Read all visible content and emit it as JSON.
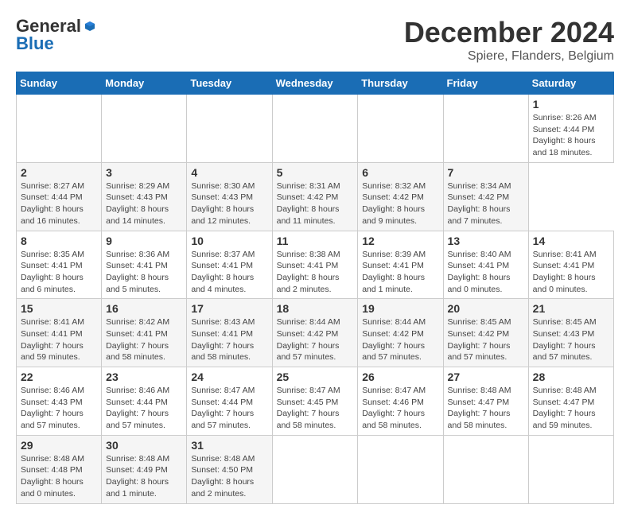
{
  "logo": {
    "general": "General",
    "blue": "Blue"
  },
  "title": {
    "month_year": "December 2024",
    "location": "Spiere, Flanders, Belgium"
  },
  "calendar": {
    "days_of_week": [
      "Sunday",
      "Monday",
      "Tuesday",
      "Wednesday",
      "Thursday",
      "Friday",
      "Saturday"
    ],
    "weeks": [
      [
        null,
        null,
        null,
        null,
        null,
        null,
        {
          "day": "1",
          "sunrise": "Sunrise: 8:26 AM",
          "sunset": "Sunset: 4:44 PM",
          "daylight": "Daylight: 8 hours and 18 minutes."
        }
      ],
      [
        {
          "day": "2",
          "sunrise": "Sunrise: 8:27 AM",
          "sunset": "Sunset: 4:44 PM",
          "daylight": "Daylight: 8 hours and 16 minutes."
        },
        {
          "day": "3",
          "sunrise": "Sunrise: 8:29 AM",
          "sunset": "Sunset: 4:43 PM",
          "daylight": "Daylight: 8 hours and 14 minutes."
        },
        {
          "day": "4",
          "sunrise": "Sunrise: 8:30 AM",
          "sunset": "Sunset: 4:43 PM",
          "daylight": "Daylight: 8 hours and 12 minutes."
        },
        {
          "day": "5",
          "sunrise": "Sunrise: 8:31 AM",
          "sunset": "Sunset: 4:42 PM",
          "daylight": "Daylight: 8 hours and 11 minutes."
        },
        {
          "day": "6",
          "sunrise": "Sunrise: 8:32 AM",
          "sunset": "Sunset: 4:42 PM",
          "daylight": "Daylight: 8 hours and 9 minutes."
        },
        {
          "day": "7",
          "sunrise": "Sunrise: 8:34 AM",
          "sunset": "Sunset: 4:42 PM",
          "daylight": "Daylight: 8 hours and 7 minutes."
        }
      ],
      [
        {
          "day": "8",
          "sunrise": "Sunrise: 8:35 AM",
          "sunset": "Sunset: 4:41 PM",
          "daylight": "Daylight: 8 hours and 6 minutes."
        },
        {
          "day": "9",
          "sunrise": "Sunrise: 8:36 AM",
          "sunset": "Sunset: 4:41 PM",
          "daylight": "Daylight: 8 hours and 5 minutes."
        },
        {
          "day": "10",
          "sunrise": "Sunrise: 8:37 AM",
          "sunset": "Sunset: 4:41 PM",
          "daylight": "Daylight: 8 hours and 4 minutes."
        },
        {
          "day": "11",
          "sunrise": "Sunrise: 8:38 AM",
          "sunset": "Sunset: 4:41 PM",
          "daylight": "Daylight: 8 hours and 2 minutes."
        },
        {
          "day": "12",
          "sunrise": "Sunrise: 8:39 AM",
          "sunset": "Sunset: 4:41 PM",
          "daylight": "Daylight: 8 hours and 1 minute."
        },
        {
          "day": "13",
          "sunrise": "Sunrise: 8:40 AM",
          "sunset": "Sunset: 4:41 PM",
          "daylight": "Daylight: 8 hours and 0 minutes."
        },
        {
          "day": "14",
          "sunrise": "Sunrise: 8:41 AM",
          "sunset": "Sunset: 4:41 PM",
          "daylight": "Daylight: 8 hours and 0 minutes."
        }
      ],
      [
        {
          "day": "15",
          "sunrise": "Sunrise: 8:41 AM",
          "sunset": "Sunset: 4:41 PM",
          "daylight": "Daylight: 7 hours and 59 minutes."
        },
        {
          "day": "16",
          "sunrise": "Sunrise: 8:42 AM",
          "sunset": "Sunset: 4:41 PM",
          "daylight": "Daylight: 7 hours and 58 minutes."
        },
        {
          "day": "17",
          "sunrise": "Sunrise: 8:43 AM",
          "sunset": "Sunset: 4:41 PM",
          "daylight": "Daylight: 7 hours and 58 minutes."
        },
        {
          "day": "18",
          "sunrise": "Sunrise: 8:44 AM",
          "sunset": "Sunset: 4:42 PM",
          "daylight": "Daylight: 7 hours and 57 minutes."
        },
        {
          "day": "19",
          "sunrise": "Sunrise: 8:44 AM",
          "sunset": "Sunset: 4:42 PM",
          "daylight": "Daylight: 7 hours and 57 minutes."
        },
        {
          "day": "20",
          "sunrise": "Sunrise: 8:45 AM",
          "sunset": "Sunset: 4:42 PM",
          "daylight": "Daylight: 7 hours and 57 minutes."
        },
        {
          "day": "21",
          "sunrise": "Sunrise: 8:45 AM",
          "sunset": "Sunset: 4:43 PM",
          "daylight": "Daylight: 7 hours and 57 minutes."
        }
      ],
      [
        {
          "day": "22",
          "sunrise": "Sunrise: 8:46 AM",
          "sunset": "Sunset: 4:43 PM",
          "daylight": "Daylight: 7 hours and 57 minutes."
        },
        {
          "day": "23",
          "sunrise": "Sunrise: 8:46 AM",
          "sunset": "Sunset: 4:44 PM",
          "daylight": "Daylight: 7 hours and 57 minutes."
        },
        {
          "day": "24",
          "sunrise": "Sunrise: 8:47 AM",
          "sunset": "Sunset: 4:44 PM",
          "daylight": "Daylight: 7 hours and 57 minutes."
        },
        {
          "day": "25",
          "sunrise": "Sunrise: 8:47 AM",
          "sunset": "Sunset: 4:45 PM",
          "daylight": "Daylight: 7 hours and 58 minutes."
        },
        {
          "day": "26",
          "sunrise": "Sunrise: 8:47 AM",
          "sunset": "Sunset: 4:46 PM",
          "daylight": "Daylight: 7 hours and 58 minutes."
        },
        {
          "day": "27",
          "sunrise": "Sunrise: 8:48 AM",
          "sunset": "Sunset: 4:47 PM",
          "daylight": "Daylight: 7 hours and 58 minutes."
        },
        {
          "day": "28",
          "sunrise": "Sunrise: 8:48 AM",
          "sunset": "Sunset: 4:47 PM",
          "daylight": "Daylight: 7 hours and 59 minutes."
        }
      ],
      [
        {
          "day": "29",
          "sunrise": "Sunrise: 8:48 AM",
          "sunset": "Sunset: 4:48 PM",
          "daylight": "Daylight: 8 hours and 0 minutes."
        },
        {
          "day": "30",
          "sunrise": "Sunrise: 8:48 AM",
          "sunset": "Sunset: 4:49 PM",
          "daylight": "Daylight: 8 hours and 1 minute."
        },
        {
          "day": "31",
          "sunrise": "Sunrise: 8:48 AM",
          "sunset": "Sunset: 4:50 PM",
          "daylight": "Daylight: 8 hours and 2 minutes."
        },
        null,
        null,
        null,
        null
      ]
    ]
  }
}
